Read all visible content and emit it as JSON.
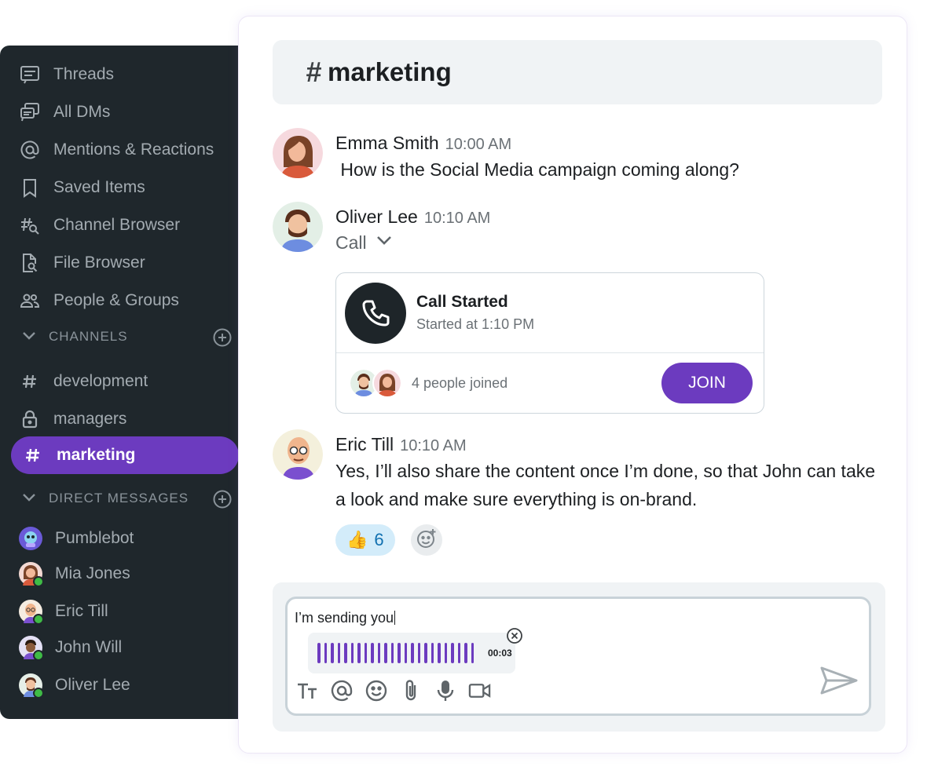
{
  "sidebar": {
    "nav": [
      {
        "label": "Threads",
        "icon": "threads-icon"
      },
      {
        "label": "All DMs",
        "icon": "all-dms-icon"
      },
      {
        "label": "Mentions & Reactions",
        "icon": "at-icon"
      },
      {
        "label": "Saved Items",
        "icon": "bookmark-icon"
      },
      {
        "label": "Channel Browser",
        "icon": "channel-search-icon"
      },
      {
        "label": "File Browser",
        "icon": "file-search-icon"
      },
      {
        "label": "People & Groups",
        "icon": "people-icon"
      }
    ],
    "channels_header": "CHANNELS",
    "channels": [
      {
        "label": "development",
        "icon": "hash-icon"
      },
      {
        "label": "managers",
        "icon": "lock-icon"
      },
      {
        "label": "marketing",
        "icon": "hash-icon",
        "active": true
      }
    ],
    "dm_header": "DIRECT MESSAGES",
    "dms": [
      {
        "label": "Pumblebot",
        "online": false
      },
      {
        "label": "Mia Jones",
        "online": true
      },
      {
        "label": "Eric Till",
        "online": true
      },
      {
        "label": "John Will",
        "online": true
      },
      {
        "label": "Oliver Lee",
        "online": true
      }
    ]
  },
  "channel": {
    "hash": "#",
    "name": "marketing"
  },
  "messages": [
    {
      "author": "Emma Smith",
      "time": "10:00 AM",
      "text": " How is the Social Media campaign coming along?"
    },
    {
      "author": "Oliver Lee",
      "time": "10:10 AM",
      "toggle": "Call",
      "call": {
        "title": "Call Started",
        "subtitle": "Started at 1:10 PM",
        "joined": "4 people joined",
        "join_label": "JOIN"
      }
    },
    {
      "author": "Eric Till",
      "time": "10:10 AM",
      "text": "Yes, I’ll also share the content once I’m done, so that John can take a look and make sure everything is on-brand.",
      "reaction": {
        "emoji": "👍",
        "count": "6"
      }
    }
  ],
  "composer": {
    "text": "I’m sending you",
    "clip_duration": "00:03"
  },
  "colors": {
    "accent": "#6c3bbf",
    "sidebar_bg": "#1f272c",
    "online": "#3fbb46",
    "reaction_bg": "#d3ecfa"
  }
}
